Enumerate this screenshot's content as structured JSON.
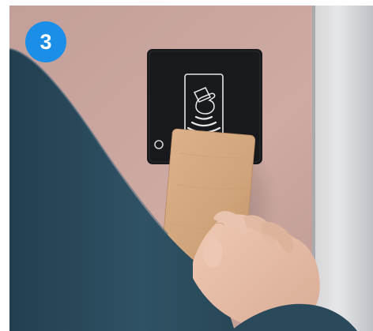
{
  "step_badge": {
    "number": "3"
  },
  "colors": {
    "badge": "#1b8fe8",
    "wall": "#c9a6a0",
    "reader_panel": "#18191c",
    "key_card": "#d3a77d",
    "sleeve": "#2d4d5f",
    "skin": "#e7c0aa",
    "door_frame": "#cfd1d4"
  },
  "icons": {
    "reader_symbol": "hand-card-icon",
    "contactless_symbol": "contactless-waves-icon",
    "indicator": "led-ring-icon"
  }
}
